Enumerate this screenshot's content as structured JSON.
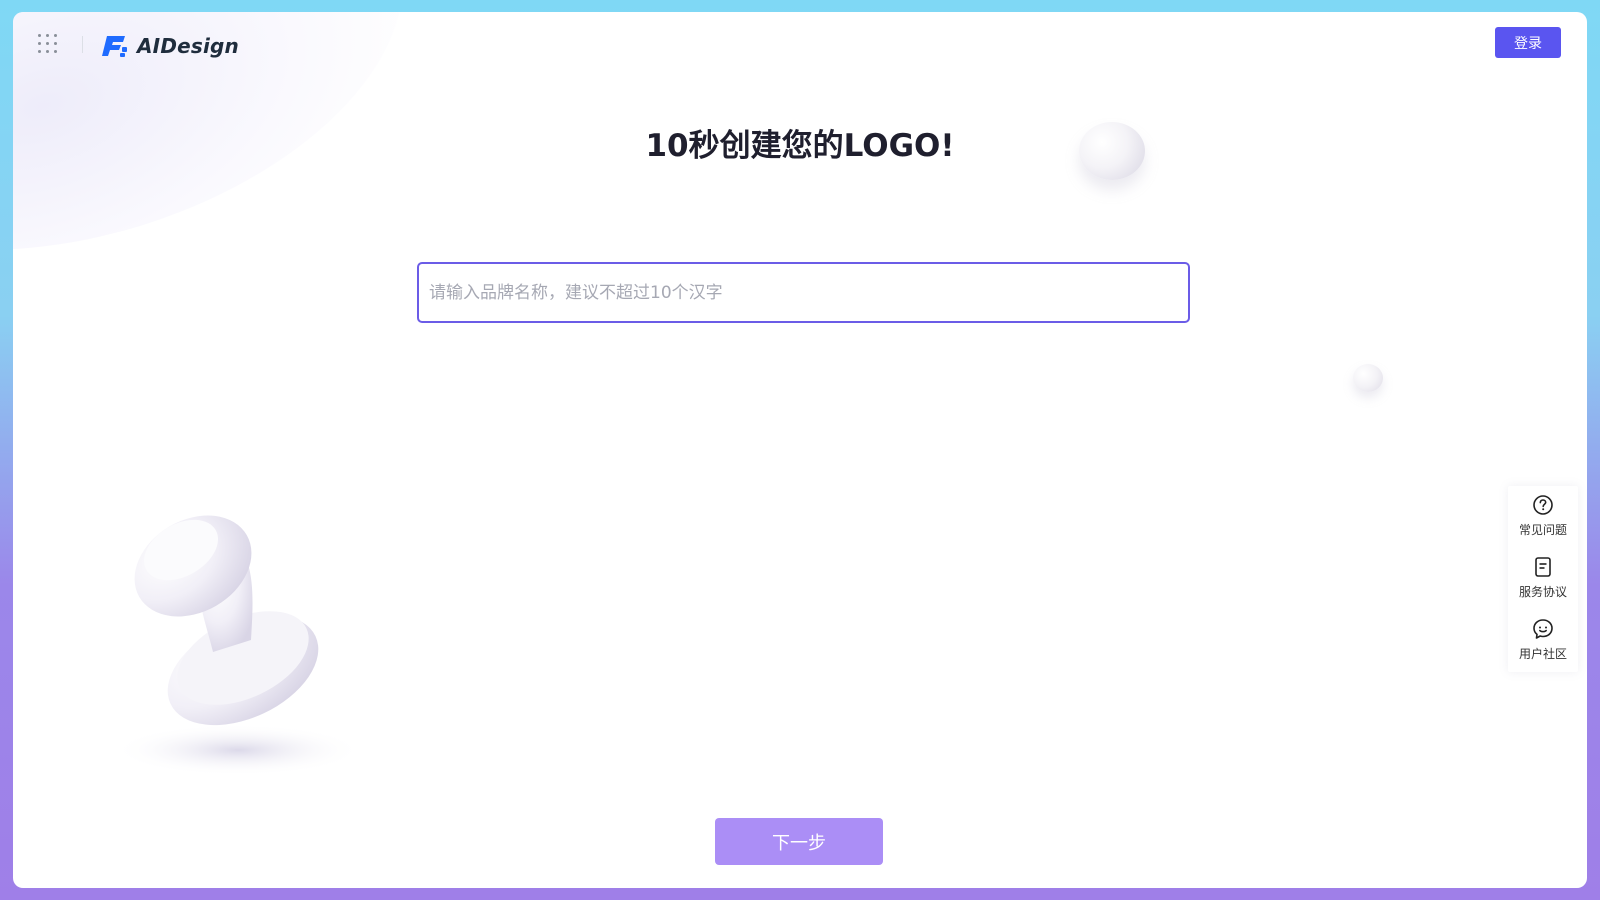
{
  "header": {
    "brand_name": "AIDesign",
    "login_label": "登录"
  },
  "main": {
    "title": "10秒创建您的LOGO!",
    "brand_input": {
      "value": "",
      "placeholder": "请输入品牌名称，建议不超过10个汉字"
    },
    "next_label": "下一步"
  },
  "side_panel": {
    "items": [
      {
        "label": "常见问题",
        "icon": "question-circle-icon"
      },
      {
        "label": "服务协议",
        "icon": "document-icon"
      },
      {
        "label": "用户社区",
        "icon": "chat-smile-icon"
      }
    ]
  },
  "colors": {
    "accent": "#5a55f0",
    "input_border": "#6b5ce7",
    "next_button": "#ab8ef6",
    "logo_blue": "#1f6bff"
  }
}
